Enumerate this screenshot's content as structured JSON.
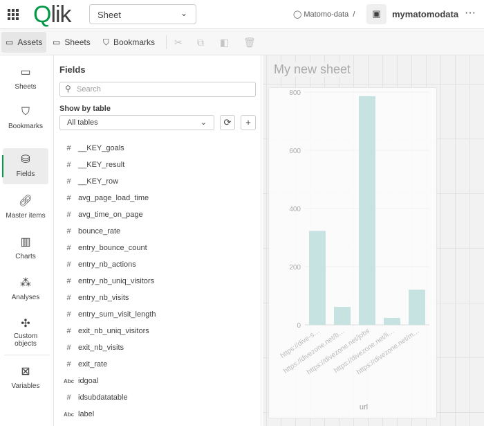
{
  "header": {
    "logo": "Qlik",
    "sheet_selector": "Sheet",
    "space": "Matomo-data",
    "separator": "/",
    "app_name": "mymatomodata",
    "more": "···"
  },
  "toolbar": {
    "assets": "Assets",
    "sheets": "Sheets",
    "bookmarks": "Bookmarks"
  },
  "rail": [
    {
      "label": "Sheets",
      "icon": "sheet-icon"
    },
    {
      "label": "Bookmarks",
      "icon": "bookmark-icon"
    },
    {
      "label": "Fields",
      "icon": "database-icon",
      "active": true
    },
    {
      "label": "Master items",
      "icon": "link-icon"
    },
    {
      "label": "Charts",
      "icon": "chart-icon"
    },
    {
      "label": "Analyses",
      "icon": "analysis-icon"
    },
    {
      "label": "Custom objects",
      "icon": "puzzle-icon"
    },
    {
      "label": "Variables",
      "icon": "variable-icon"
    }
  ],
  "panel": {
    "title": "Fields",
    "search_placeholder": "Search",
    "show_by_table": "Show by table",
    "table_select": "All tables",
    "fields": [
      {
        "t": "#",
        "n": "__KEY_goals"
      },
      {
        "t": "#",
        "n": "__KEY_result"
      },
      {
        "t": "#",
        "n": "__KEY_row"
      },
      {
        "t": "#",
        "n": "avg_page_load_time"
      },
      {
        "t": "#",
        "n": "avg_time_on_page"
      },
      {
        "t": "#",
        "n": "bounce_rate"
      },
      {
        "t": "#",
        "n": "entry_bounce_count"
      },
      {
        "t": "#",
        "n": "entry_nb_actions"
      },
      {
        "t": "#",
        "n": "entry_nb_uniq_visitors"
      },
      {
        "t": "#",
        "n": "entry_nb_visits"
      },
      {
        "t": "#",
        "n": "entry_sum_visit_length"
      },
      {
        "t": "#",
        "n": "exit_nb_uniq_visitors"
      },
      {
        "t": "#",
        "n": "exit_nb_visits"
      },
      {
        "t": "#",
        "n": "exit_rate"
      },
      {
        "t": "Abc",
        "n": "idgoal"
      },
      {
        "t": "#",
        "n": "idsubdatatable"
      },
      {
        "t": "Abc",
        "n": "label"
      }
    ]
  },
  "sheet": {
    "title": "My new sheet"
  },
  "chart_data": {
    "type": "bar",
    "categories": [
      "https://dive-s…",
      "https://divezone.net/b…",
      "https://divezone.net/jobs",
      "https://divezone.net/li…",
      "https://divezone.net/m…"
    ],
    "values": [
      323,
      62,
      786,
      24,
      121
    ],
    "xlabel": "url",
    "ylabel": "",
    "ylim": [
      0,
      800
    ],
    "yticks": [
      0,
      200,
      400,
      600,
      800
    ],
    "color": "#c6e2e1"
  }
}
